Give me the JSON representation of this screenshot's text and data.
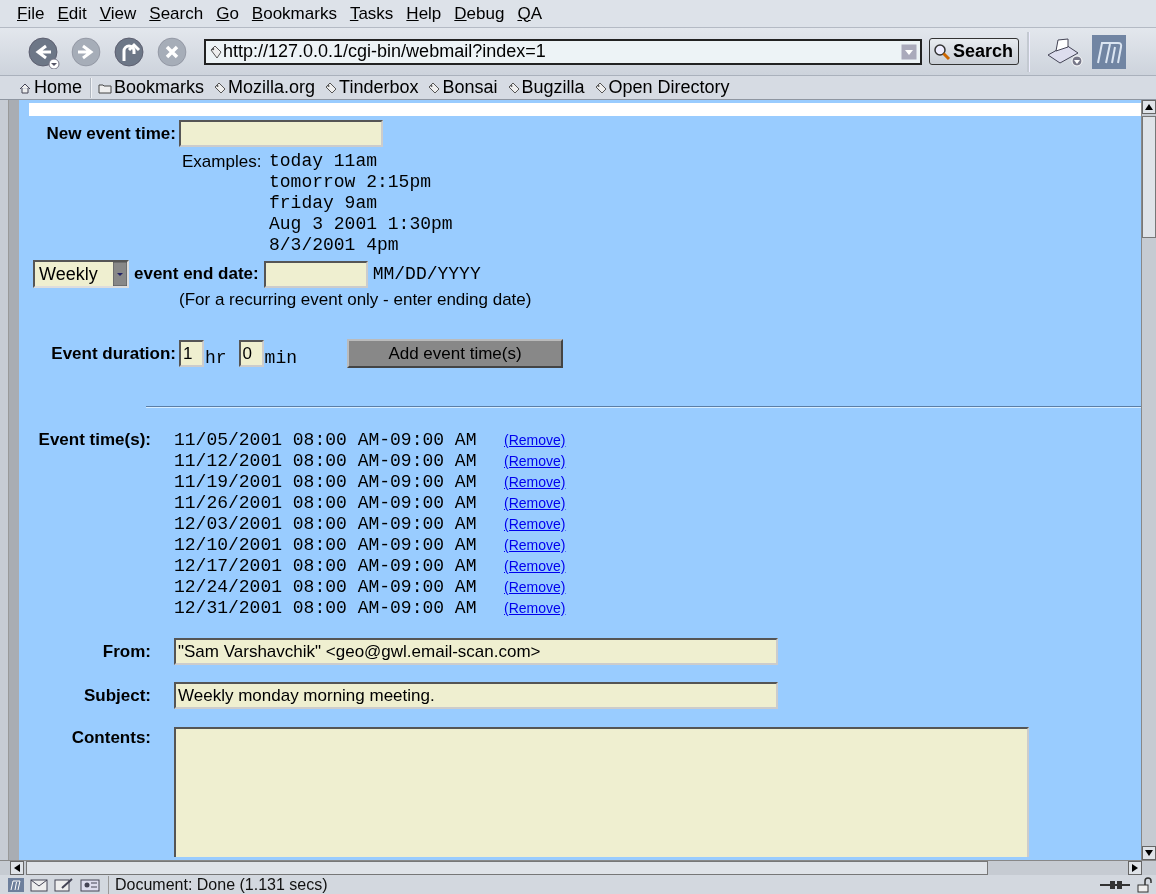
{
  "menu": [
    "File",
    "Edit",
    "View",
    "Search",
    "Go",
    "Bookmarks",
    "Tasks",
    "Help",
    "Debug",
    "QA"
  ],
  "navigation": {
    "buttons": [
      {
        "kind": "back",
        "disabled": false
      },
      {
        "kind": "forward",
        "disabled": true
      },
      {
        "kind": "reload",
        "disabled": false
      },
      {
        "kind": "stop",
        "disabled": true
      }
    ],
    "url": "http://127.0.0.1/cgi-bin/webmail?index=1",
    "search_button": "Search"
  },
  "bookmarks": [
    {
      "kind": "home",
      "label": "Home"
    },
    {
      "kind": "folder",
      "label": "Bookmarks"
    },
    {
      "kind": "link",
      "label": "Mozilla.org"
    },
    {
      "kind": "link",
      "label": "Tinderbox"
    },
    {
      "kind": "link",
      "label": "Bonsai"
    },
    {
      "kind": "link",
      "label": "Bugzilla"
    },
    {
      "kind": "link",
      "label": "Open Directory"
    }
  ],
  "form": {
    "new_event_time": {
      "label": "New event time:"
    },
    "examples_label": "Examples:",
    "examples": [
      "today 11am",
      "tomorrow 2:15pm",
      "friday 9am",
      "Aug 3 2001 1:30pm",
      "8/3/2001 4pm"
    ],
    "recurrence": {
      "value": "Weekly"
    },
    "end_date": {
      "label": "event end date:",
      "hint": "MM/DD/YYYY",
      "note": "(For a recurring event only - enter ending date)"
    },
    "duration": {
      "label": "Event duration:",
      "hours": "1",
      "hours_unit": "hr",
      "minutes": "0",
      "minutes_unit": "min"
    },
    "add_button": "Add event time(s)",
    "event_times_label": "Event time(s):",
    "event_times": [
      {
        "time": "11/05/2001 08:00 AM-09:00 AM",
        "link": "(Remove)"
      },
      {
        "time": "11/12/2001 08:00 AM-09:00 AM",
        "link": "(Remove)"
      },
      {
        "time": "11/19/2001 08:00 AM-09:00 AM",
        "link": "(Remove)"
      },
      {
        "time": "11/26/2001 08:00 AM-09:00 AM",
        "link": "(Remove)"
      },
      {
        "time": "12/03/2001 08:00 AM-09:00 AM",
        "link": "(Remove)"
      },
      {
        "time": "12/10/2001 08:00 AM-09:00 AM",
        "link": "(Remove)"
      },
      {
        "time": "12/17/2001 08:00 AM-09:00 AM",
        "link": "(Remove)"
      },
      {
        "time": "12/24/2001 08:00 AM-09:00 AM",
        "link": "(Remove)"
      },
      {
        "time": "12/31/2001 08:00 AM-09:00 AM",
        "link": "(Remove)"
      }
    ],
    "from": {
      "label": "From:",
      "value": "\"Sam Varshavchik\" <geo@gwl.email-scan.com>"
    },
    "subject": {
      "label": "Subject:",
      "value": "Weekly monday morning meeting."
    },
    "contents": {
      "label": "Contents:"
    }
  },
  "status_bar": "Document: Done (1.131 secs)"
}
